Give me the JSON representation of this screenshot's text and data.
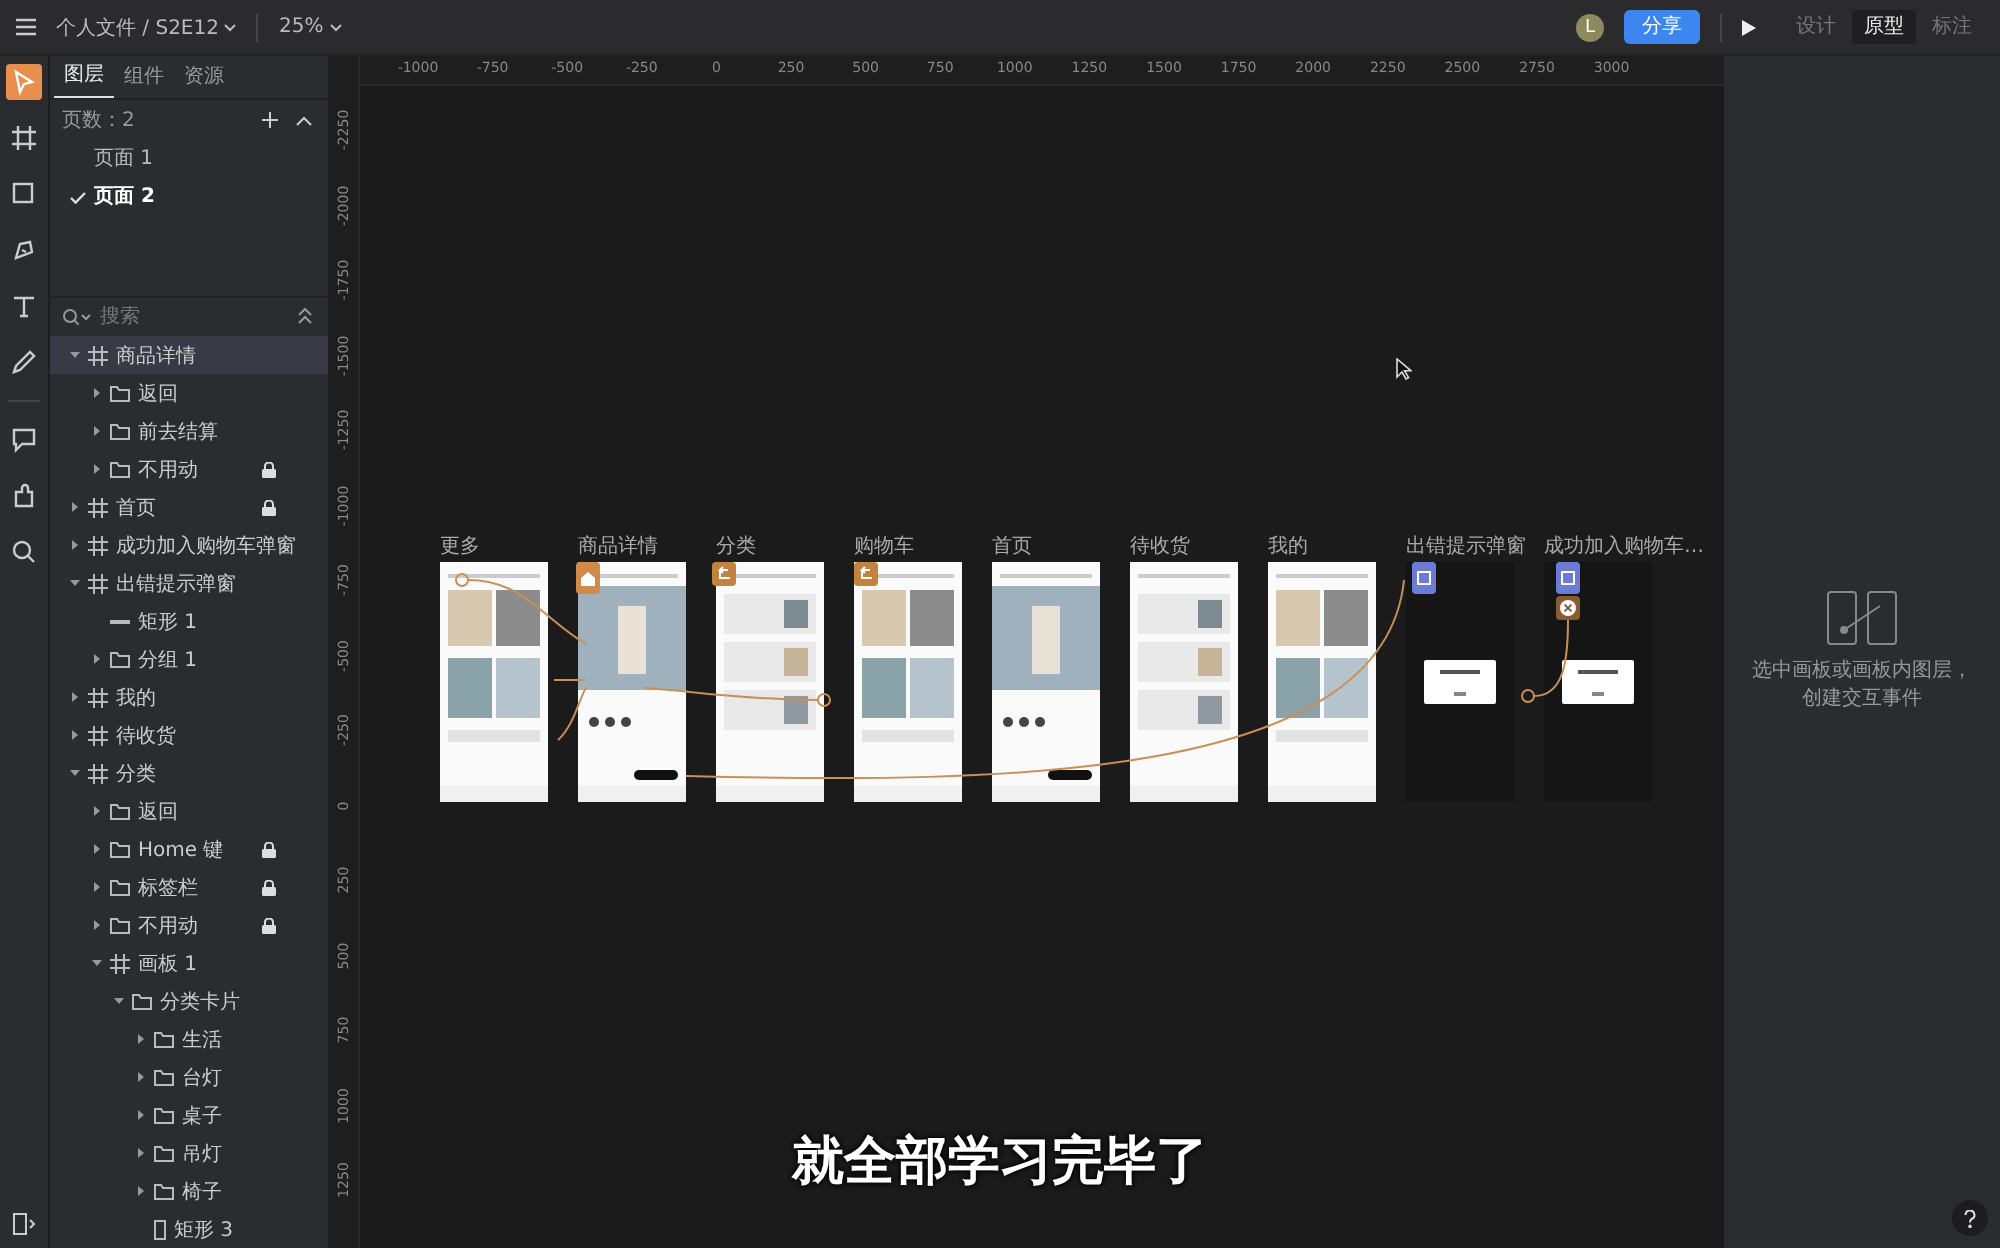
{
  "top_bar": {
    "breadcrumb": "个人文件 / S2E12",
    "zoom": "25%",
    "avatar": "L",
    "share_button": "分享",
    "modes": [
      {
        "label": "设计",
        "selected": false
      },
      {
        "label": "原型",
        "selected": true
      },
      {
        "label": "标注",
        "selected": false
      }
    ]
  },
  "toolbar": [
    {
      "kind": "select",
      "selected": true
    },
    {
      "kind": "frame",
      "selected": false
    },
    {
      "kind": "rectangle",
      "selected": false
    },
    {
      "kind": "pen",
      "selected": false
    },
    {
      "kind": "text",
      "selected": false
    },
    {
      "kind": "pencil",
      "selected": false
    },
    {
      "kind": "comment",
      "selected": false
    },
    {
      "kind": "plugin",
      "selected": false
    },
    {
      "kind": "search",
      "selected": false
    }
  ],
  "panel_tabs": [
    {
      "label": "图层",
      "selected": true
    },
    {
      "label": "组件",
      "selected": false
    },
    {
      "label": "资源",
      "selected": false
    }
  ],
  "pages": {
    "count": "页数：2",
    "items": [
      {
        "label": "页面 1",
        "selected": false
      },
      {
        "label": "页面 2",
        "selected": true
      }
    ]
  },
  "layer_search": {
    "placeholder": "搜索"
  },
  "layers": [
    {
      "name": "商品详情",
      "kind": "frame",
      "expanded": true,
      "locked": false,
      "selected": true,
      "children": [
        {
          "name": "返回",
          "kind": "folder",
          "expanded": false,
          "locked": false,
          "selected": false
        },
        {
          "name": "前去结算",
          "kind": "folder",
          "expanded": false,
          "locked": false,
          "selected": false
        },
        {
          "name": "不用动",
          "kind": "folder",
          "expanded": false,
          "locked": true,
          "selected": false
        }
      ]
    },
    {
      "name": "首页",
      "kind": "frame",
      "expanded": false,
      "locked": true,
      "selected": false
    },
    {
      "name": "成功加入购物车弹窗",
      "kind": "frame",
      "expanded": false,
      "locked": false,
      "selected": false
    },
    {
      "name": "出错提示弹窗",
      "kind": "frame",
      "expanded": true,
      "locked": false,
      "selected": false,
      "children": [
        {
          "name": "矩形 1",
          "kind": "line",
          "locked": false,
          "selected": false
        },
        {
          "name": "分组 1",
          "kind": "folder",
          "expanded": false,
          "locked": false,
          "selected": false
        }
      ]
    },
    {
      "name": "我的",
      "kind": "frame",
      "expanded": false,
      "locked": false,
      "selected": false
    },
    {
      "name": "待收货",
      "kind": "frame",
      "expanded": false,
      "locked": false,
      "selected": false
    },
    {
      "name": "分类",
      "kind": "frame",
      "expanded": true,
      "locked": false,
      "selected": false,
      "children": [
        {
          "name": "返回",
          "kind": "folder",
          "expanded": false,
          "locked": false,
          "selected": false
        },
        {
          "name": "Home 键",
          "kind": "folder",
          "expanded": false,
          "locked": true,
          "selected": false
        },
        {
          "name": "标签栏",
          "kind": "folder",
          "expanded": false,
          "locked": true,
          "selected": false
        },
        {
          "name": "不用动",
          "kind": "folder",
          "expanded": false,
          "locked": true,
          "selected": false
        },
        {
          "name": "画板 1",
          "kind": "frame",
          "expanded": true,
          "locked": false,
          "selected": false,
          "children": [
            {
              "name": "分类卡片",
              "kind": "folder",
              "expanded": true,
              "locked": false,
              "selected": false,
              "children": [
                {
                  "name": "生活",
                  "kind": "folder",
                  "expanded": false,
                  "locked": false,
                  "selected": false
                },
                {
                  "name": "台灯",
                  "kind": "folder",
                  "expanded": false,
                  "locked": false,
                  "selected": false
                },
                {
                  "name": "桌子",
                  "kind": "folder",
                  "expanded": false,
                  "locked": false,
                  "selected": false
                },
                {
                  "name": "吊灯",
                  "kind": "folder",
                  "expanded": false,
                  "locked": false,
                  "selected": false
                },
                {
                  "name": "椅子",
                  "kind": "folder",
                  "expanded": false,
                  "locked": false,
                  "selected": false
                },
                {
                  "name": "矩形 3",
                  "kind": "rectangle",
                  "locked": false,
                  "selected": false
                }
              ]
            }
          ]
        }
      ]
    }
  ],
  "rulers": {
    "horizontal": [
      "-1000",
      "-750",
      "-500",
      "-250",
      "0",
      "250",
      "500",
      "750",
      "1000",
      "1250",
      "1500",
      "1750",
      "2000",
      "2250",
      "2500",
      "2750",
      "3000"
    ],
    "vertical": [
      "-2250",
      "-2000",
      "-1750",
      "-1500",
      "-1250",
      "-1000",
      "-750",
      "-500",
      "-250",
      "0",
      "250",
      "500",
      "750",
      "1000",
      "1250"
    ]
  },
  "artboards": [
    {
      "label": "更多",
      "kind": "screen"
    },
    {
      "label": "商品详情",
      "kind": "screen"
    },
    {
      "label": "分类",
      "kind": "screen"
    },
    {
      "label": "购物车",
      "kind": "screen"
    },
    {
      "label": "首页",
      "kind": "screen"
    },
    {
      "label": "待收货",
      "kind": "screen"
    },
    {
      "label": "我的",
      "kind": "screen"
    },
    {
      "label": "出错提示弹窗",
      "kind": "dialog"
    },
    {
      "label": "成功加入购物车…",
      "kind": "dialog"
    }
  ],
  "inspector": {
    "hint": "选中画板或画板内图层，创建交互事件"
  },
  "subtitle": "就全部学习完毕了"
}
